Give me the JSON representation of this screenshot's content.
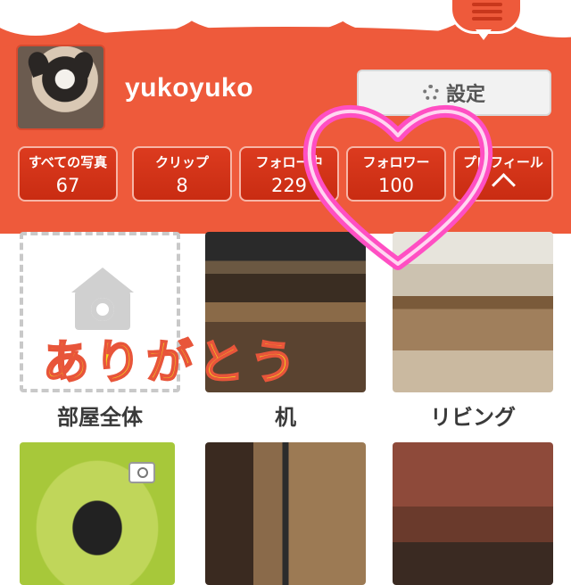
{
  "profile": {
    "username": "yukoyuko",
    "settings_label": "設定"
  },
  "stats": [
    {
      "label": "すべての写真",
      "value": "67"
    },
    {
      "label": "クリップ",
      "value": "8"
    },
    {
      "label": "フォロー中",
      "value": "229"
    },
    {
      "label": "フォロワー",
      "value": "100"
    },
    {
      "label": "プロフィール",
      "value": ""
    }
  ],
  "albums": [
    {
      "label": "部屋全体"
    },
    {
      "label": "机"
    },
    {
      "label": "リビング"
    }
  ],
  "overlay": {
    "text": "ありがとう"
  },
  "colors": {
    "header": "#ee5a3b",
    "stat_button": "#d13419",
    "heart": "#ff4fc3",
    "overlay_text": "#f3e320"
  }
}
